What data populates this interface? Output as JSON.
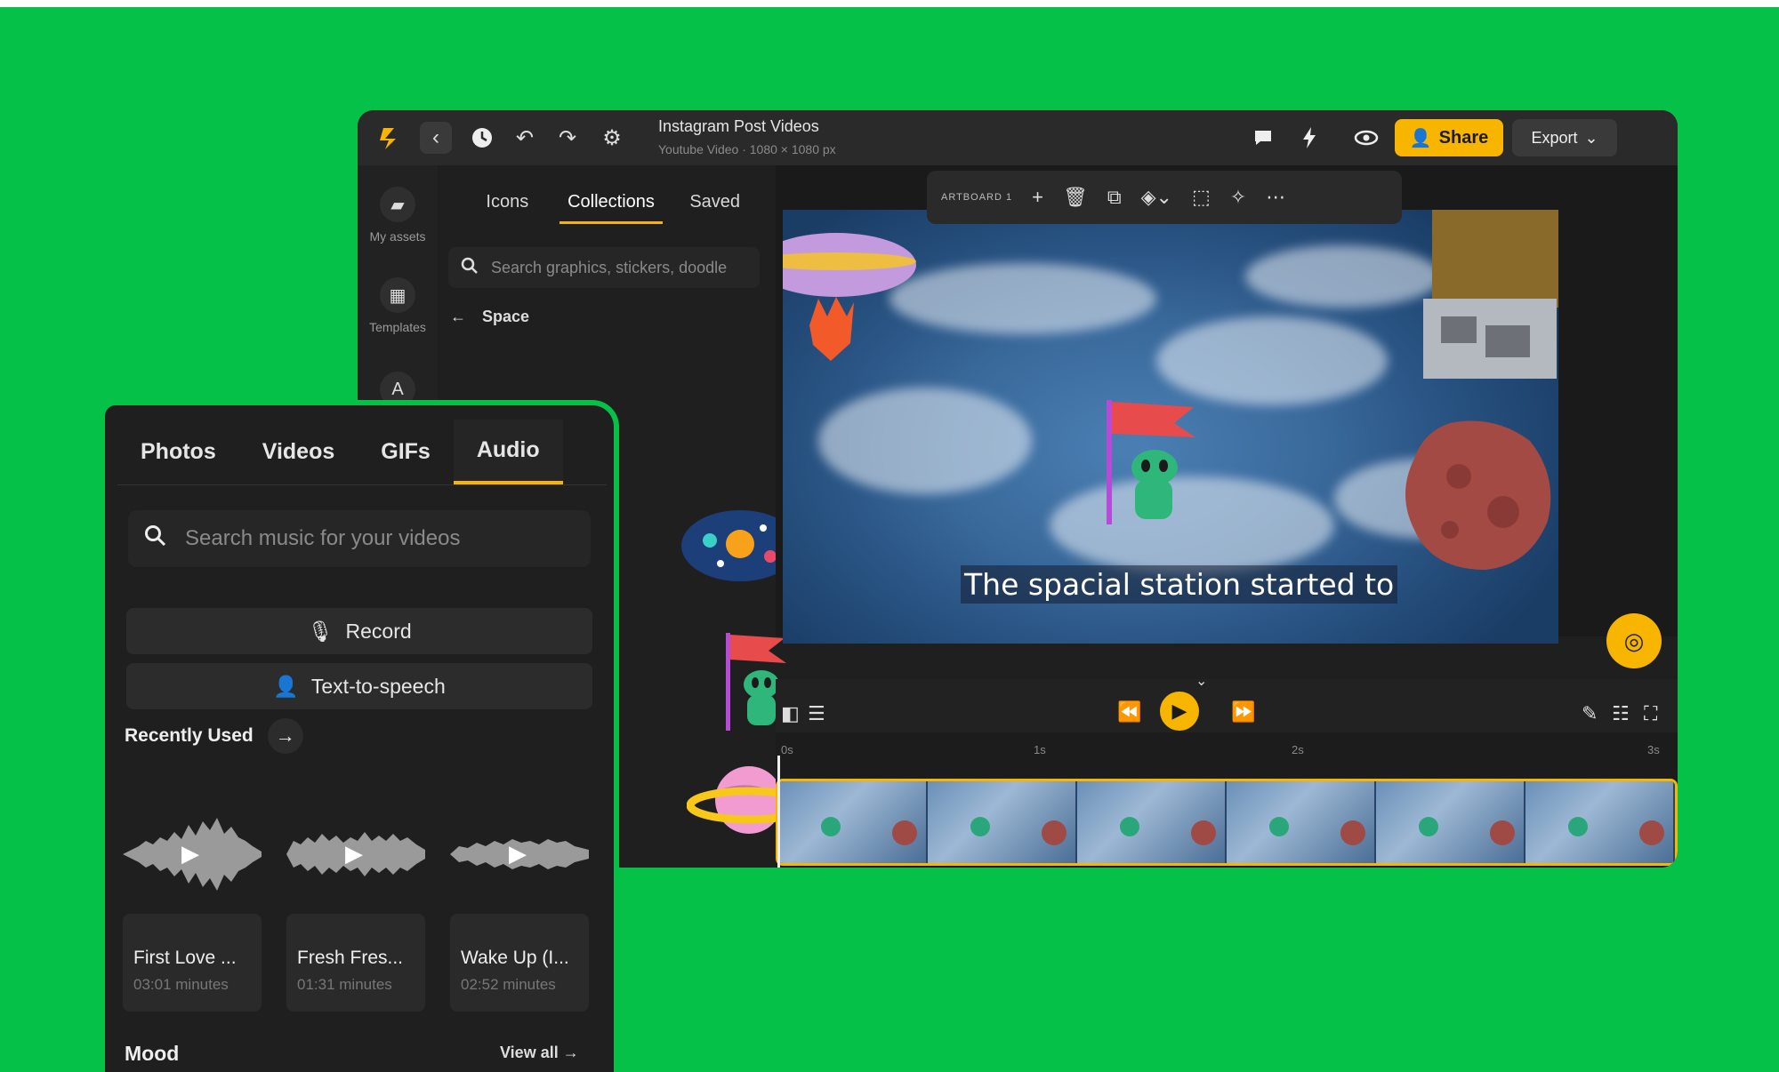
{
  "editor": {
    "project_title": "Instagram Post Videos",
    "project_subtitle": "Youtube Video · 1080 × 1080 px",
    "share_label": "Share",
    "export_label": "Export",
    "rail": [
      {
        "label": "My assets"
      },
      {
        "label": "Templates"
      }
    ],
    "graphics_tabs": [
      "Icons",
      "Collections",
      "Saved"
    ],
    "graphics_active_tab": "Collections",
    "graphics_search_placeholder": "Search graphics, stickers, doodle",
    "collection_name": "Space",
    "artboard_label": "ARTBOARD 1",
    "caption": "The spacial station started to",
    "timeline_ticks": [
      "0s",
      "1s",
      "2s",
      "3s"
    ]
  },
  "audio_panel": {
    "tabs": [
      "Photos",
      "Videos",
      "GIFs",
      "Audio"
    ],
    "active_tab": "Audio",
    "search_placeholder": "Search music for your videos",
    "record_label": "Record",
    "tts_label": "Text-to-speech",
    "recently_used_title": "Recently Used",
    "tracks": [
      {
        "name": "First Love ...",
        "duration": "03:01 minutes"
      },
      {
        "name": "Fresh Fres...",
        "duration": "01:31 minutes"
      },
      {
        "name": "Wake Up (I...",
        "duration": "02:52 minutes"
      }
    ],
    "mood_title": "Mood",
    "view_all_label": "View all"
  },
  "colors": {
    "background_green": "#05c148",
    "accent_yellow": "#f7b500",
    "panel_dark": "#1f1f20"
  }
}
